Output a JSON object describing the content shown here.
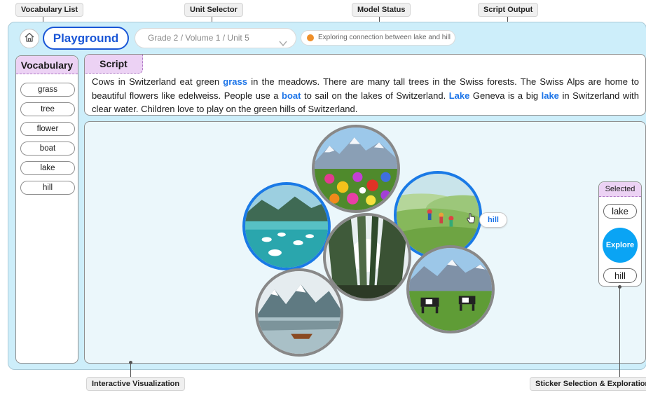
{
  "annotations": {
    "vocabulary_list": "Vocabulary List",
    "unit_selector": "Unit Selector",
    "model_status": "Model Status",
    "script_output": "Script Output",
    "interactive_visualization": "Interactive Visualization",
    "sticker_selection": "Sticker Selection & Exploration"
  },
  "header": {
    "home_icon": "home-icon",
    "title": "Playground",
    "unit_selector_value": "Grade 2 / Volume 1 / Unit 5",
    "status_text": "Exploring connection between lake and hill",
    "status_color": "#ef8f2a",
    "accent_color": "#1a56d6"
  },
  "vocabulary": {
    "title": "Vocabulary",
    "items": [
      "grass",
      "tree",
      "flower",
      "boat",
      "lake",
      "hill"
    ]
  },
  "script": {
    "title": "Script",
    "segments": [
      {
        "text": "Cows in Switzerland eat green ",
        "highlight": false
      },
      {
        "text": "grass",
        "highlight": true
      },
      {
        "text": " in the meadows. There are many tall trees in the Swiss forests. The Swiss Alps are home to beautiful flowers like edelweiss. People use a ",
        "highlight": false
      },
      {
        "text": "boat",
        "highlight": true
      },
      {
        "text": " to sail on the lakes of Switzerland. ",
        "highlight": false
      },
      {
        "text": "Lake",
        "highlight": true
      },
      {
        "text": " Geneva is a big ",
        "highlight": false
      },
      {
        "text": "lake",
        "highlight": true
      },
      {
        "text": " in Switzerland with clear water. Children love to play on the green hills of Switzerland.",
        "highlight": false
      }
    ],
    "highlight_color": "#1a73e8"
  },
  "visualization": {
    "stickers": [
      {
        "name": "flowers-sticker",
        "selected": false
      },
      {
        "name": "hill-sticker",
        "selected": true
      },
      {
        "name": "lake-swans-sticker",
        "selected": true
      },
      {
        "name": "trees-sticker",
        "selected": false
      },
      {
        "name": "cows-sticker",
        "selected": false
      },
      {
        "name": "boat-sticker",
        "selected": false
      }
    ],
    "hover_label": "hill",
    "selected_border_color": "#1a7ae6"
  },
  "selected_panel": {
    "title": "Selected",
    "items": [
      "lake",
      "hill"
    ],
    "explore_label": "Explore",
    "explore_color": "#0aa4f4"
  }
}
